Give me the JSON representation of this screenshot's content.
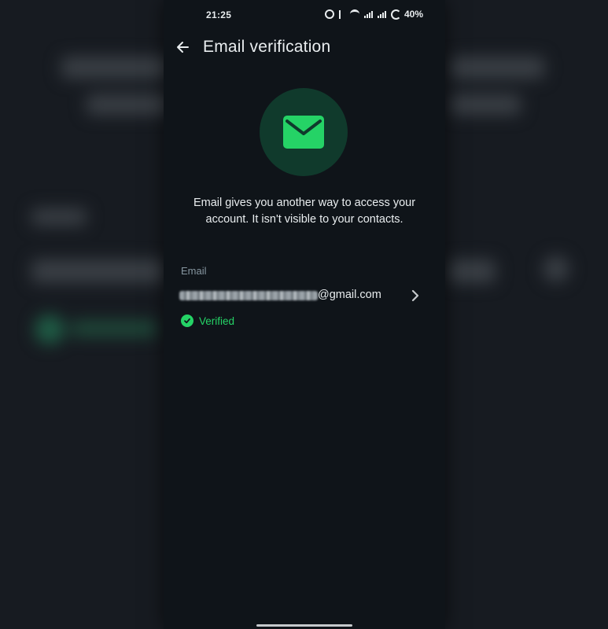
{
  "status_bar": {
    "time": "21:25",
    "battery": "40%"
  },
  "header": {
    "title": "Email verification",
    "back_icon": "arrow-left-icon"
  },
  "hero": {
    "icon": "envelope-icon",
    "color": "#25d366"
  },
  "description": "Email gives you another way to access your account. It isn't visible to your contacts.",
  "email": {
    "label": "Email",
    "domain": "@gmail.com"
  },
  "status": {
    "text": "Verified",
    "color": "#25d366"
  }
}
